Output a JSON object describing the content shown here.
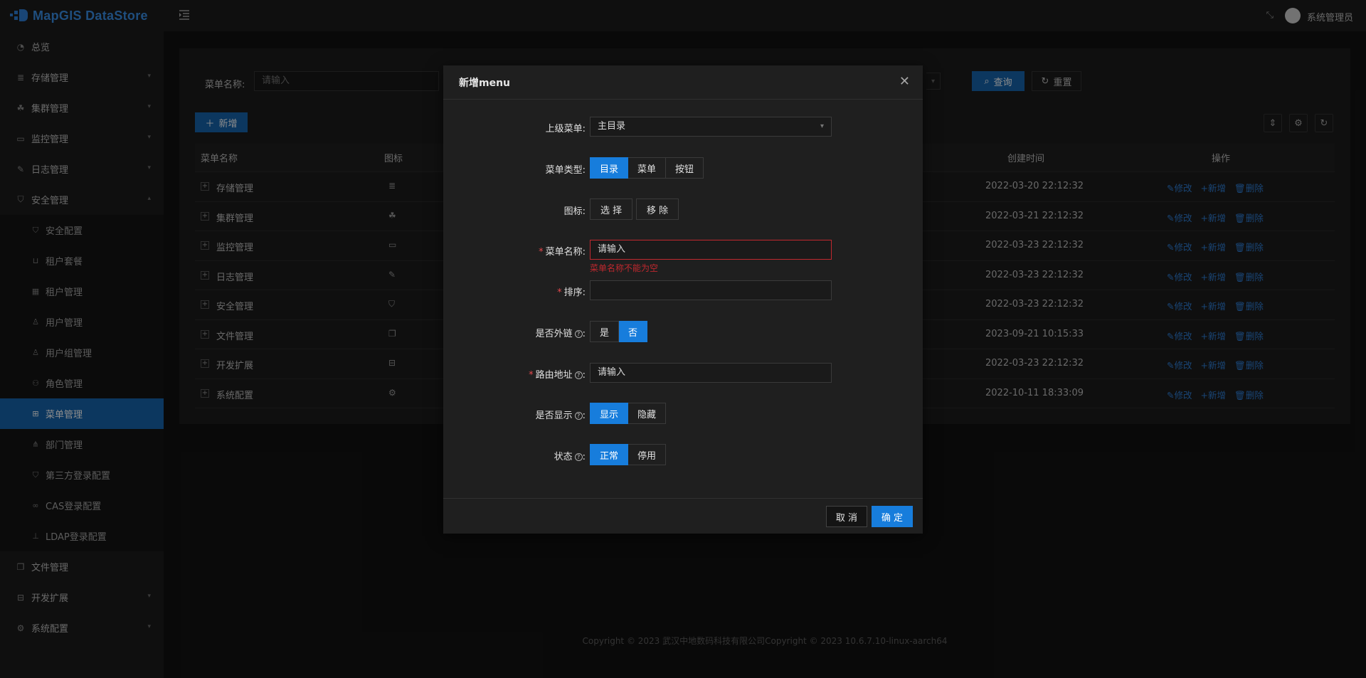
{
  "app": {
    "logo_text": "MapGIS DataStore"
  },
  "header": {
    "user_name": "系统管理员"
  },
  "sidebar": {
    "items": [
      {
        "label": "总览",
        "icon": "dashboard-icon"
      },
      {
        "label": "存储管理",
        "icon": "storage-icon"
      },
      {
        "label": "集群管理",
        "icon": "cluster-icon"
      },
      {
        "label": "监控管理",
        "icon": "monitor-icon"
      },
      {
        "label": "日志管理",
        "icon": "log-icon"
      },
      {
        "label": "安全管理",
        "icon": "shield-icon"
      },
      {
        "label": "文件管理",
        "icon": "file-icon"
      },
      {
        "label": "开发扩展",
        "icon": "toolbox-icon"
      },
      {
        "label": "系统配置",
        "icon": "gear-icon"
      }
    ],
    "sub_items": [
      {
        "label": "安全配置"
      },
      {
        "label": "租户套餐"
      },
      {
        "label": "租户管理"
      },
      {
        "label": "用户管理"
      },
      {
        "label": "用户组管理"
      },
      {
        "label": "角色管理"
      },
      {
        "label": "菜单管理"
      },
      {
        "label": "部门管理"
      },
      {
        "label": "第三方登录配置"
      },
      {
        "label": "CAS登录配置"
      },
      {
        "label": "LDAP登录配置"
      }
    ]
  },
  "filter": {
    "label": "菜单名称:",
    "placeholder": "请输入",
    "search_label": "查询",
    "reset_label": "重置"
  },
  "toolbar": {
    "add_label": "新增"
  },
  "table": {
    "headers": {
      "name": "菜单名称",
      "icon": "图标",
      "created": "创建时间",
      "ops": "操作"
    },
    "ops": {
      "edit": "修改",
      "add": "新增",
      "delete": "删除"
    },
    "rows": [
      {
        "name": "存储管理",
        "time": "2022-03-20 22:12:32"
      },
      {
        "name": "集群管理",
        "time": "2022-03-21 22:12:32"
      },
      {
        "name": "监控管理",
        "time": "2022-03-23 22:12:32"
      },
      {
        "name": "日志管理",
        "time": "2022-03-23 22:12:32"
      },
      {
        "name": "安全管理",
        "time": "2022-03-23 22:12:32"
      },
      {
        "name": "文件管理",
        "time": "2023-09-21 10:15:33"
      },
      {
        "name": "开发扩展",
        "time": "2022-03-23 22:12:32"
      },
      {
        "name": "系统配置",
        "time": "2022-10-11 18:33:09"
      }
    ]
  },
  "modal": {
    "title": "新增menu",
    "parent_label": "上级菜单:",
    "parent_value": "主目录",
    "type_label": "菜单类型:",
    "type_options": [
      "目录",
      "菜单",
      "按钮"
    ],
    "icon_label": "图标:",
    "icon_select": "选 择",
    "icon_remove": "移 除",
    "name_label": "菜单名称:",
    "name_placeholder": "请输入",
    "name_error": "菜单名称不能为空",
    "order_label": "排序:",
    "external_label": "是否外链",
    "external_options": [
      "是",
      "否"
    ],
    "route_label": "路由地址",
    "route_placeholder": "请输入",
    "visible_label": "是否显示",
    "visible_options": [
      "显示",
      "隐藏"
    ],
    "status_label": "状态",
    "status_options": [
      "正常",
      "停用"
    ],
    "cancel_label": "取 消",
    "ok_label": "确 定"
  },
  "footer": {
    "text": "Copyright © 2023 武汉中地数码科技有限公司Copyright © 2023 10.6.7.10-linux-aarch64"
  }
}
